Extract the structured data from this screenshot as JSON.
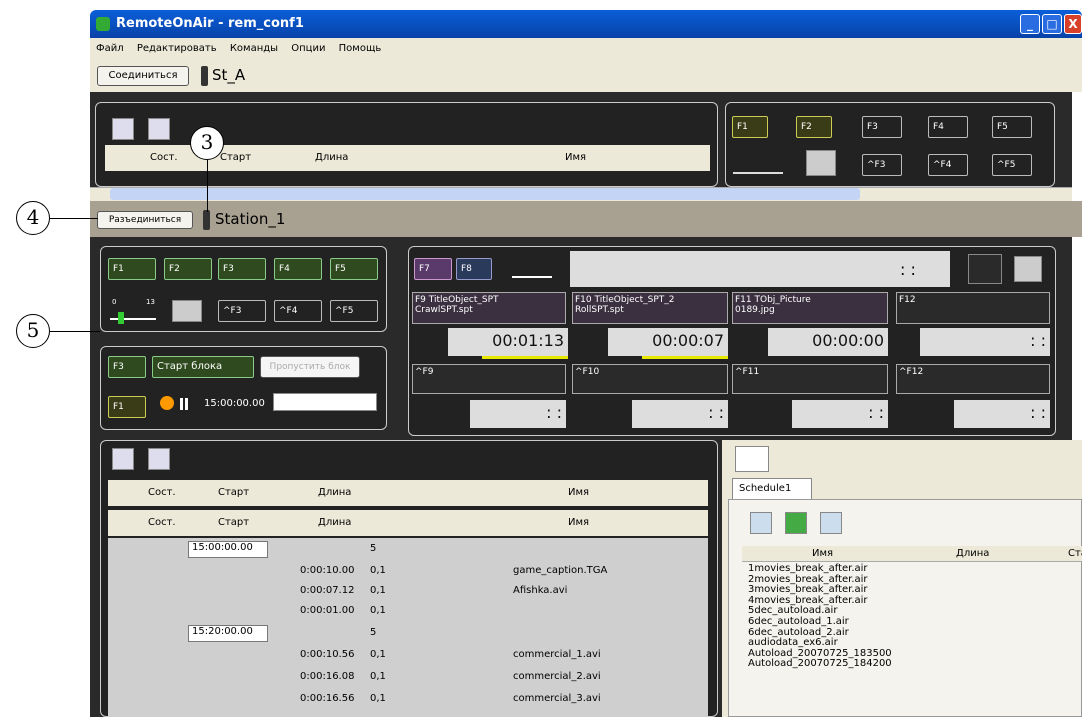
{
  "window": {
    "title": "RemoteOnAir - rem_conf1"
  },
  "menu": [
    "Файл",
    "Редактировать",
    "Команды",
    "Опции",
    "Помощь"
  ],
  "top_station": {
    "button": "Соединиться",
    "name": "St_A"
  },
  "station": {
    "button": "Разъединиться",
    "name": "Station_1"
  },
  "callouts": [
    "3",
    "4",
    "5"
  ],
  "fkeys": {
    "f1": "F1",
    "f2": "F2",
    "f3": "F3",
    "f4": "F4",
    "f5": "F5",
    "cf3": "^F3",
    "cf4": "^F4",
    "cf5": "^F5",
    "f7": "F7",
    "f8": "F8"
  },
  "slider": {
    "min": "0",
    "max": "13"
  },
  "block": {
    "f3": "F3",
    "start": "Старт блока",
    "skip": "Пропустить блок",
    "f1": "F1",
    "time": "15:00:00.00"
  },
  "slots": [
    {
      "key": "F9",
      "label": "TitleObject_SPT",
      "file": "CrawlSPT.spt",
      "time": "00:01:13"
    },
    {
      "key": "F10",
      "label": "TitleObject_SPT_2",
      "file": "RollSPT.spt",
      "time": "00:00:07"
    },
    {
      "key": "F11",
      "label": "TObj_Picture",
      "file": "0189.jpg",
      "time": "00:00:00"
    },
    {
      "key": "F12",
      "label": "",
      "file": "",
      "time": ": :"
    }
  ],
  "ctrl_slots": [
    "^F9",
    "^F10",
    "^F11",
    "^F12"
  ],
  "empty_time": ": :",
  "columns": {
    "state": "Сост.",
    "start": "Старт",
    "length": "Длина",
    "name": "Имя"
  },
  "rows": [
    {
      "start": "15:00:00.00",
      "length": "",
      "val": "5",
      "name": ""
    },
    {
      "start": "",
      "length": "0:00:10.00",
      "val": "0,1",
      "name": "game_caption.TGA"
    },
    {
      "start": "",
      "length": "0:00:07.12",
      "val": "0,1",
      "name": "Afishka.avi"
    },
    {
      "start": "",
      "length": "0:00:01.00",
      "val": "0,1",
      "name": ""
    },
    {
      "start": "15:20:00.00",
      "length": "",
      "val": "5",
      "name": ""
    },
    {
      "start": "",
      "length": "0:00:10.56",
      "val": "0,1",
      "name": "commercial_1.avi"
    },
    {
      "start": "",
      "length": "0:00:16.08",
      "val": "0,1",
      "name": "commercial_2.avi"
    },
    {
      "start": "",
      "length": "0:00:16.56",
      "val": "0,1",
      "name": "commercial_3.avi"
    }
  ],
  "schedule": {
    "tab": "Schedule1",
    "col_name": "Имя",
    "col_length": "Длина",
    "col_start": "Ста",
    "items": [
      "1movies_break_after.air",
      "2movies_break_after.air",
      "3movies_break_after.air",
      "4movies_break_after.air",
      "5dec_autoload.air",
      "6dec_autoload_1.air",
      "6dec_autoload_2.air",
      "audiodata_ex6.air",
      "Autoload_20070725_183500",
      "Autoload_20070725_184200"
    ]
  }
}
